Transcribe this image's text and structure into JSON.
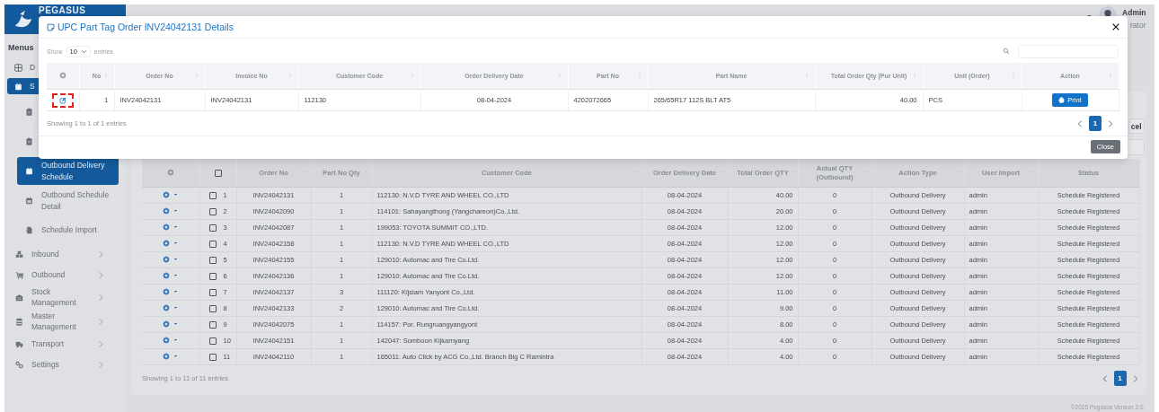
{
  "logo": {
    "text": "PEGASUS"
  },
  "header": {
    "user_name": "Admin",
    "user_role": "rator"
  },
  "sidebar": {
    "title": "Menus",
    "items": [
      {
        "label": "D",
        "kind": "link",
        "selected": false
      },
      {
        "label": "S",
        "kind": "section",
        "selected": true,
        "children": [
          {
            "selected": false
          },
          {
            "selected": false
          },
          {
            "label": "Outbound Delivery Schedule",
            "selected": true
          },
          {
            "label": "Outbound Schedule Detail",
            "selected": false
          },
          {
            "label": "Schedule Import",
            "selected": false
          }
        ]
      },
      {
        "label": "Inbound",
        "kind": "group",
        "expanded": false
      },
      {
        "label": "Outbound",
        "kind": "group",
        "expanded": false
      },
      {
        "label": "Stock Management",
        "kind": "group",
        "expanded": false
      },
      {
        "label": "Master Management",
        "kind": "group",
        "expanded": false
      },
      {
        "label": "Transport",
        "kind": "group",
        "expanded": false
      },
      {
        "label": "Settings",
        "kind": "group",
        "expanded": false
      }
    ]
  },
  "toolbar": {
    "export_button": "cel"
  },
  "schedule_table": {
    "header_checked": false,
    "columns": [
      "Order No",
      "Part No Qty",
      "Customer Code",
      "Order Delivery Date",
      "Total Order QTY",
      "Actual QTY (Outbound)",
      "Action Type",
      "User Import",
      "Status"
    ],
    "rows": [
      {
        "no": "1",
        "checked": false,
        "cells": [
          "INV24042131",
          "1",
          "112130: N.V.D TYRE AND WHEEL CO.,LTD",
          "08-04-2024",
          "40.00",
          "0",
          "Outbound Delivery",
          "admin",
          "Schedule Registered"
        ]
      },
      {
        "no": "2",
        "checked": false,
        "cells": [
          "INV24042090",
          "1",
          "114101: Sahayangthong (Yangchareon)Co.,Ltd.",
          "08-04-2024",
          "20.00",
          "0",
          "Outbound Delivery",
          "admin",
          "Schedule Registered"
        ]
      },
      {
        "no": "3",
        "checked": false,
        "cells": [
          "INV24042087",
          "1",
          "199053: TOYOTA SUMMIT CO.,LTD.",
          "08-04-2024",
          "12.00",
          "0",
          "Outbound Delivery",
          "admin",
          "Schedule Registered"
        ]
      },
      {
        "no": "4",
        "checked": false,
        "cells": [
          "INV24042158",
          "1",
          "112130: N.V.D TYRE AND WHEEL CO.,LTD",
          "08-04-2024",
          "12.00",
          "0",
          "Outbound Delivery",
          "admin",
          "Schedule Registered"
        ]
      },
      {
        "no": "5",
        "checked": false,
        "cells": [
          "INV24042155",
          "1",
          "129010: Automac and Tire Co.Ltd.",
          "08-04-2024",
          "12.00",
          "0",
          "Outbound Delivery",
          "admin",
          "Schedule Registered"
        ]
      },
      {
        "no": "6",
        "checked": false,
        "cells": [
          "INV24042136",
          "1",
          "129010: Automac and Tire Co.Ltd.",
          "08-04-2024",
          "12.00",
          "0",
          "Outbound Delivery",
          "admin",
          "Schedule Registered"
        ]
      },
      {
        "no": "7",
        "checked": false,
        "cells": [
          "INV24042137",
          "3",
          "111120: Kijsiam Yanyont Co.,Ltd.",
          "08-04-2024",
          "11.00",
          "0",
          "Outbound Delivery",
          "admin",
          "Schedule Registered"
        ]
      },
      {
        "no": "8",
        "checked": false,
        "cells": [
          "INV24042133",
          "2",
          "129010: Automac and Tire Co.Ltd.",
          "08-04-2024",
          "9.00",
          "0",
          "Outbound Delivery",
          "admin",
          "Schedule Registered"
        ]
      },
      {
        "no": "9",
        "checked": false,
        "cells": [
          "INV24042075",
          "1",
          "114157: Por. Rungruangyangyont",
          "08-04-2024",
          "8.00",
          "0",
          "Outbound Delivery",
          "admin",
          "Schedule Registered"
        ]
      },
      {
        "no": "10",
        "checked": false,
        "cells": [
          "INV24042151",
          "1",
          "142047: Somboon Kijkarnyang",
          "08-04-2024",
          "4.00",
          "0",
          "Outbound Delivery",
          "admin",
          "Schedule Registered"
        ]
      },
      {
        "no": "11",
        "checked": false,
        "cells": [
          "INV24042110",
          "1",
          "165011: Auto Click by ACG Co.,Ltd. Branch Big C Ramintra",
          "08-04-2024",
          "4.00",
          "0",
          "Outbound Delivery",
          "admin",
          "Schedule Registered"
        ]
      }
    ],
    "info": "Showing 1 to 11 of 11 entries",
    "pages": [
      {
        "label": "1",
        "selected": true
      }
    ]
  },
  "footer": {
    "text": "©2025 Pegasus Version 2.0"
  },
  "modal": {
    "title": "UPC Part Tag Order INV24042131 Details",
    "show_label": "Show",
    "page_length": "10",
    "entries_label": "entries",
    "columns": [
      "No",
      "Order No",
      "Invoice No",
      "Customer Code",
      "Order Delivery Date",
      "Part No",
      "Part Name",
      "Total Order Qty (Pur Unit)",
      "Unit (Order)",
      "Action"
    ],
    "rows": [
      {
        "highlighted": true,
        "cells": [
          "1",
          "INV24042131",
          "INV24042131",
          "112130",
          "08-04-2024",
          "4202072665",
          "265/65R17 112S BLT AT5",
          "40.00",
          "PCS"
        ],
        "action": "Print"
      }
    ],
    "info": "Showing 1 to 1 of 1 entries",
    "pages": [
      {
        "label": "1",
        "selected": true
      }
    ],
    "close_button": "Close"
  }
}
